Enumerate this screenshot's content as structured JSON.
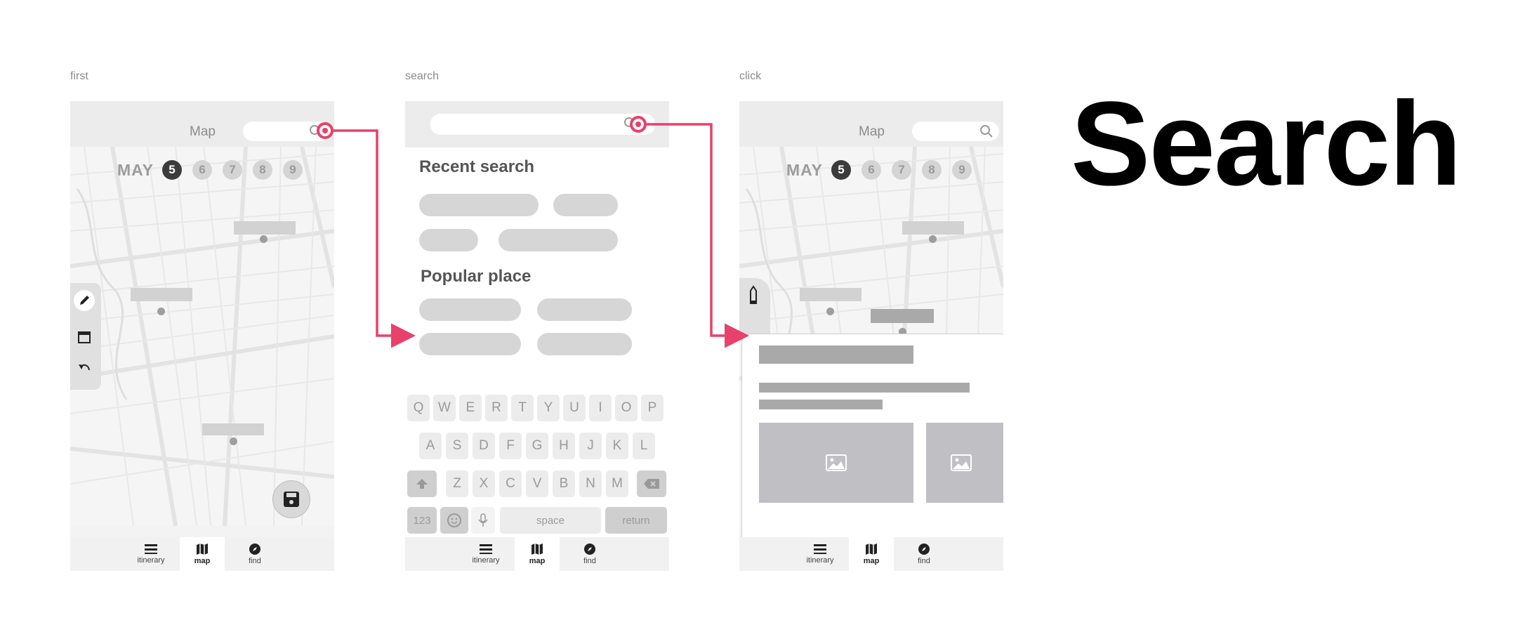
{
  "headline": "Search",
  "frames": {
    "first": {
      "label": "first",
      "title": "Map",
      "month": "MAY",
      "days": [
        "5",
        "6",
        "7",
        "8",
        "9"
      ],
      "selected_day": "5"
    },
    "search": {
      "label": "search",
      "recent_title": "Recent search",
      "popular_title": "Popular place",
      "keyboard": {
        "row1": [
          "Q",
          "W",
          "E",
          "R",
          "T",
          "Y",
          "U",
          "I",
          "O",
          "P"
        ],
        "row2": [
          "A",
          "S",
          "D",
          "F",
          "G",
          "H",
          "J",
          "K",
          "L"
        ],
        "row3": [
          "Z",
          "X",
          "C",
          "V",
          "B",
          "N",
          "M"
        ],
        "numbers_key": "123",
        "space_key": "space",
        "return_key": "return"
      }
    },
    "click": {
      "label": "click",
      "title": "Map",
      "month": "MAY",
      "days": [
        "5",
        "6",
        "7",
        "8",
        "9"
      ],
      "selected_day": "5"
    }
  },
  "tabs": [
    "itinerary",
    "map",
    "find"
  ],
  "active_tab": "map",
  "icons": [
    "search-icon",
    "pencil-icon",
    "calendar-icon",
    "undo-icon",
    "save-icon",
    "menu-icon",
    "map-icon",
    "compass-icon",
    "shift-icon",
    "backspace-icon",
    "emoji-icon",
    "mic-icon",
    "image-icon"
  ],
  "colors": {
    "accent": "#e8416b",
    "wire": "#d2d2d2",
    "dark": "#3c3c3c"
  }
}
